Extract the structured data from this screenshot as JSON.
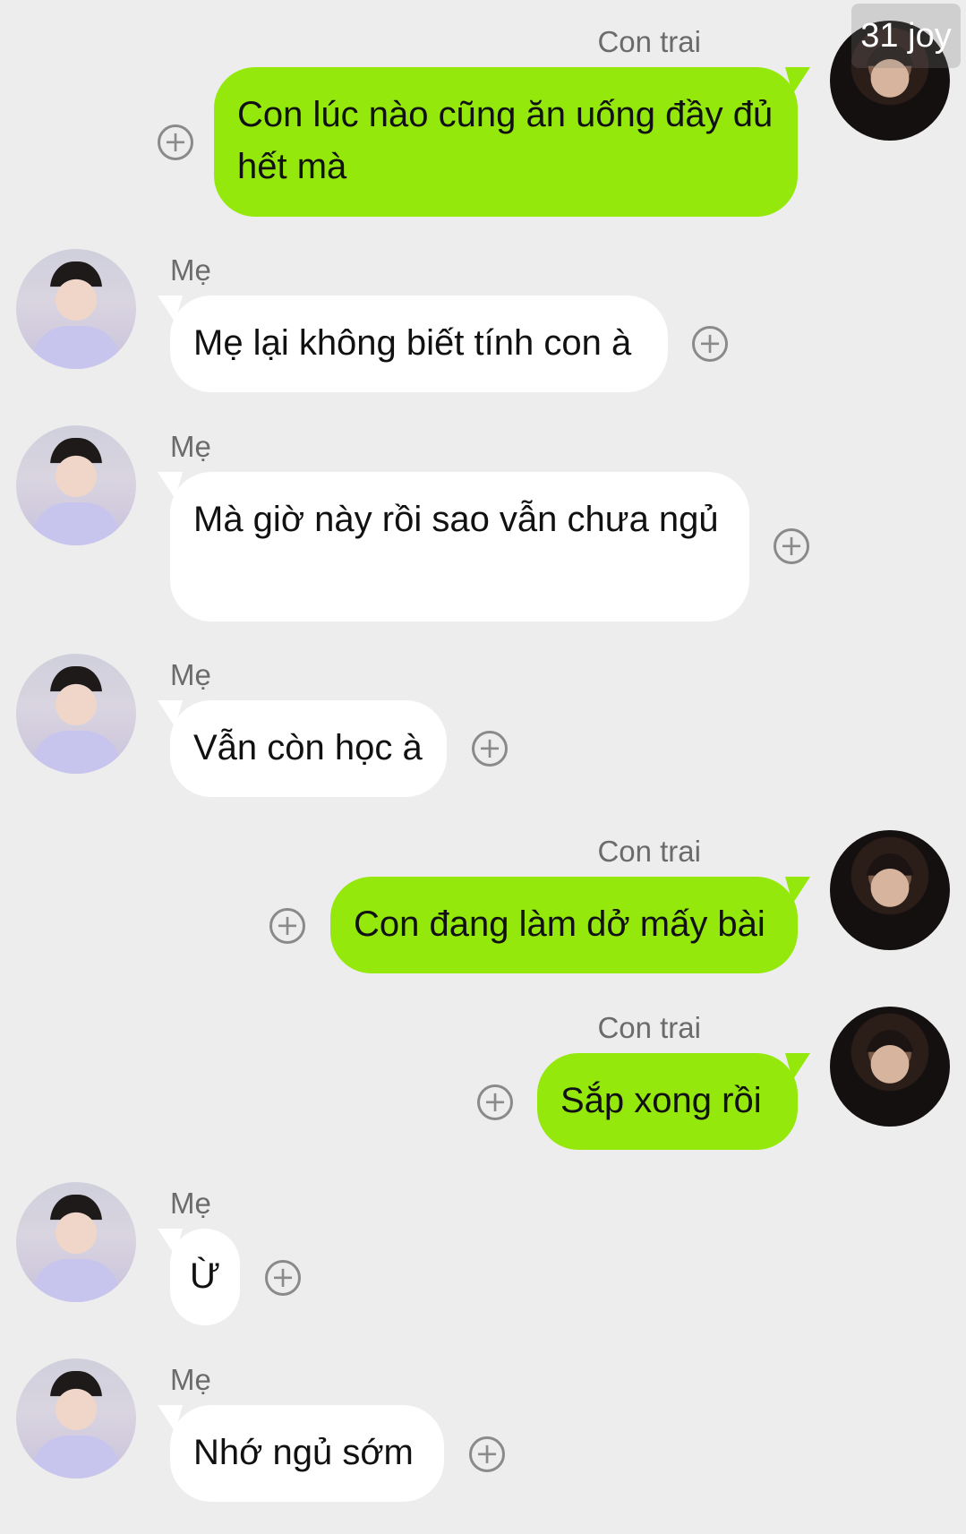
{
  "watermark": "31 joy",
  "messages": [
    {
      "sender": "Con trai",
      "text": "Con lúc nào cũng ăn uống đầy đủ hết mà"
    },
    {
      "sender": "Mẹ",
      "text": "Mẹ lại không biết tính con à"
    },
    {
      "sender": "Mẹ",
      "text": "Mà giờ này rồi sao vẫn chưa ngủ"
    },
    {
      "sender": "Mẹ",
      "text": "Vẫn còn học à"
    },
    {
      "sender": "Con trai",
      "text": "Con đang làm dở mấy bài"
    },
    {
      "sender": "Con trai",
      "text": "Sắp xong rồi"
    },
    {
      "sender": "Mẹ",
      "text": "Ừ"
    },
    {
      "sender": "Mẹ",
      "text": "Nhớ ngủ sớm"
    }
  ],
  "colors": {
    "outgoing_bubble": "#94e80b",
    "incoming_bubble": "#ffffff",
    "background": "#ededed"
  },
  "icons": {
    "add": "plus-circle-icon"
  }
}
